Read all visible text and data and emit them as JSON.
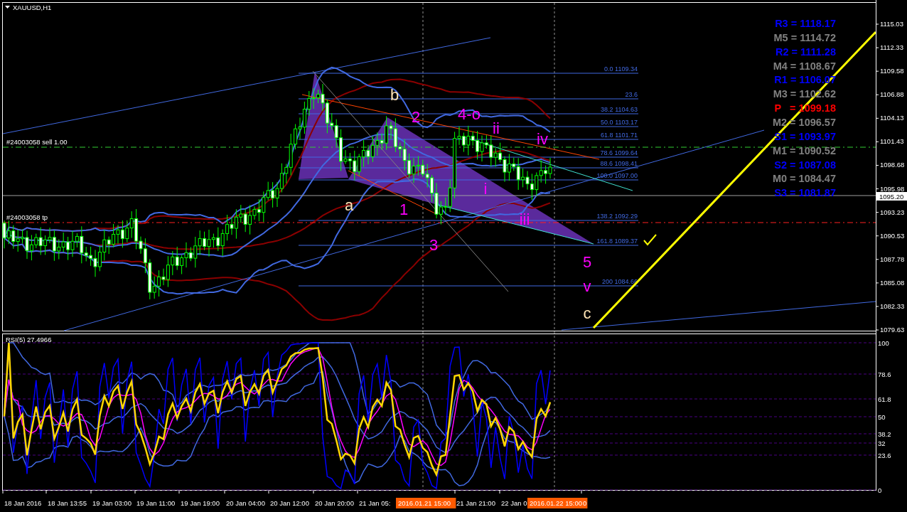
{
  "chart": {
    "title": "XAUUSD,H1",
    "price_axis": [
      "1115.03",
      "1112.33",
      "1109.58",
      "1106.88",
      "1104.13",
      "1101.43",
      "1098.68",
      "1095.98",
      "1093.23",
      "1090.53",
      "1087.78",
      "1085.08",
      "1082.33",
      "1079.63"
    ],
    "current_price": "1095.20",
    "orders": [
      {
        "label": "#24003058 sell 1.00",
        "kind": "entry"
      },
      {
        "label": "#24003058 tp",
        "kind": "take_profit"
      }
    ],
    "fib_levels": [
      {
        "label": "0.0 1109.34"
      },
      {
        "label": "23.6"
      },
      {
        "label": "38.2 1104.63"
      },
      {
        "label": "50.0 1103.17"
      },
      {
        "label": "61.8 1101.71"
      },
      {
        "label": "78.6 1099.64"
      },
      {
        "label": "88.6 1098.41"
      },
      {
        "label": "100.0 1097.00"
      },
      {
        "label": "138.2 1092.29"
      },
      {
        "label": "161.8 1089.37"
      },
      {
        "label": "200 1084.66"
      }
    ],
    "pivots": [
      {
        "label": "R3 = 1118.17",
        "color": "#0000ff"
      },
      {
        "label": "M5 = 1114.72",
        "color": "#808080"
      },
      {
        "label": "R2 = 1111.28",
        "color": "#0000ff"
      },
      {
        "label": "M4 = 1108.67",
        "color": "#808080"
      },
      {
        "label": "R1 = 1106.07",
        "color": "#0000ff"
      },
      {
        "label": "M3 = 1102.62",
        "color": "#808080"
      },
      {
        "label": "P   = 1099.18",
        "color": "#ff0000"
      },
      {
        "label": "M2 = 1096.57",
        "color": "#808080"
      },
      {
        "label": "S1 = 1093.97",
        "color": "#0000ff"
      },
      {
        "label": "M1 = 1090.52",
        "color": "#808080"
      },
      {
        "label": "S2 = 1087.08",
        "color": "#0000ff"
      },
      {
        "label": "M0 = 1084.47",
        "color": "#808080"
      },
      {
        "label": "S3 = 1081.87",
        "color": "#0000ff"
      }
    ],
    "waves": [
      {
        "label": "a",
        "color": "#ffe4b5"
      },
      {
        "label": "b",
        "color": "#ffe4b5"
      },
      {
        "label": "1",
        "color": "#ff00ff"
      },
      {
        "label": "2",
        "color": "#ff00ff"
      },
      {
        "label": "3",
        "color": "#ff00ff"
      },
      {
        "label": "4-o",
        "color": "#ff00ff"
      },
      {
        "label": "i",
        "color": "#ff00ff"
      },
      {
        "label": "ii",
        "color": "#ff00ff"
      },
      {
        "label": "iii",
        "color": "#ff00ff"
      },
      {
        "label": "iv",
        "color": "#ff00ff"
      },
      {
        "label": "5",
        "color": "#ff00ff"
      },
      {
        "label": "v",
        "color": "#ff00ff"
      },
      {
        "label": "c",
        "color": "#ffe4b5"
      }
    ]
  },
  "rsi": {
    "title": "RSI(5) 27.4966",
    "axis": [
      "100",
      "78.6",
      "61.8",
      "50",
      "38.2",
      "32",
      "23.6",
      "0"
    ]
  },
  "time_axis": [
    {
      "label": "18 Jan 2016",
      "kind": "tick"
    },
    {
      "label": "18 Jan 13:55",
      "kind": "tick"
    },
    {
      "label": "19 Jan 03:00",
      "kind": "tick"
    },
    {
      "label": "19 Jan 11:00",
      "kind": "tick"
    },
    {
      "label": "19 Jan 19:00",
      "kind": "tick"
    },
    {
      "label": "20 Jan 04:00",
      "kind": "tick"
    },
    {
      "label": "20 Jan 12:00",
      "kind": "tick"
    },
    {
      "label": "20 Jan 20:00",
      "kind": "tick"
    },
    {
      "label": "21 Jan 05:",
      "kind": "tick"
    },
    {
      "label": "2016.01.21 15:00",
      "kind": "marker"
    },
    {
      "label": "21 Jan 21:00",
      "kind": "tick"
    },
    {
      "label": "22 Jan 0",
      "kind": "tick"
    },
    {
      "label": "2016.01.22 15:00",
      "kind": "marker"
    },
    {
      "label": "0",
      "kind": "tick"
    }
  ]
}
